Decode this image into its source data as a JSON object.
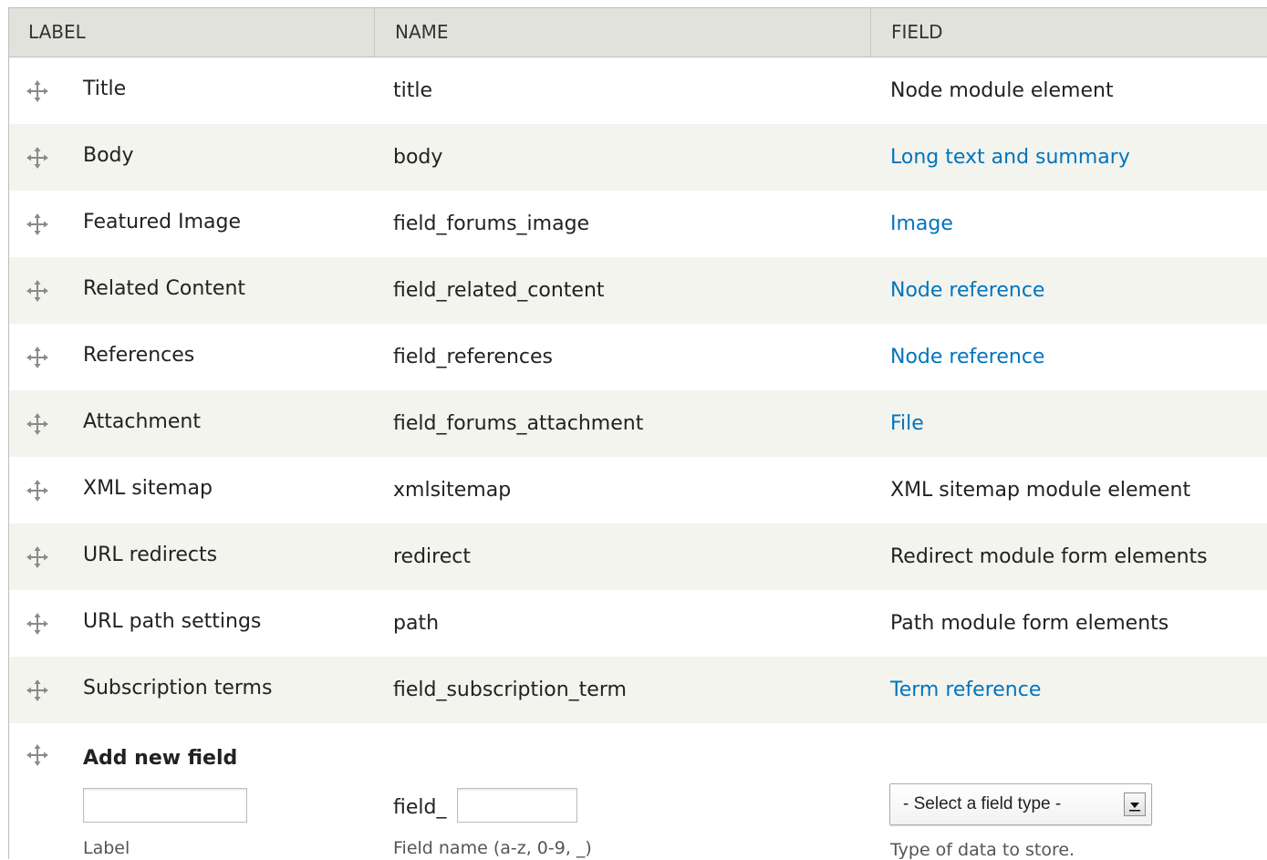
{
  "header": {
    "label": "LABEL",
    "name": "NAME",
    "field": "FIELD"
  },
  "rows": [
    {
      "label": "Title",
      "name": "title",
      "field": "Node module element",
      "field_is_link": false
    },
    {
      "label": "Body",
      "name": "body",
      "field": "Long text and summary",
      "field_is_link": true
    },
    {
      "label": "Featured Image",
      "name": "field_forums_image",
      "field": "Image",
      "field_is_link": true
    },
    {
      "label": "Related Content",
      "name": "field_related_content",
      "field": "Node reference",
      "field_is_link": true
    },
    {
      "label": "References",
      "name": "field_references",
      "field": "Node reference",
      "field_is_link": true
    },
    {
      "label": "Attachment",
      "name": "field_forums_attachment",
      "field": "File",
      "field_is_link": true
    },
    {
      "label": "XML sitemap",
      "name": "xmlsitemap",
      "field": "XML sitemap module element",
      "field_is_link": false
    },
    {
      "label": "URL redirects",
      "name": "redirect",
      "field": "Redirect module form elements",
      "field_is_link": false
    },
    {
      "label": "URL path settings",
      "name": "path",
      "field": "Path module form elements",
      "field_is_link": false
    },
    {
      "label": "Subscription terms",
      "name": "field_subscription_term",
      "field": "Term reference",
      "field_is_link": true
    }
  ],
  "add_new": {
    "title": "Add new field",
    "label_value": "",
    "label_desc": "Label",
    "name_prefix": "field_",
    "name_value": "",
    "name_desc": "Field name (a-z, 0-9, _)",
    "type_select": "- Select a field type -",
    "type_desc": "Type of data to store."
  },
  "colors": {
    "link": "#0074bd",
    "header_bg": "#e1e2dc",
    "stripe_bg": "#f3f4ee"
  },
  "icons": {
    "drag_handle": "drag-handle-icon",
    "select_arrow": "chevron-down-icon"
  }
}
